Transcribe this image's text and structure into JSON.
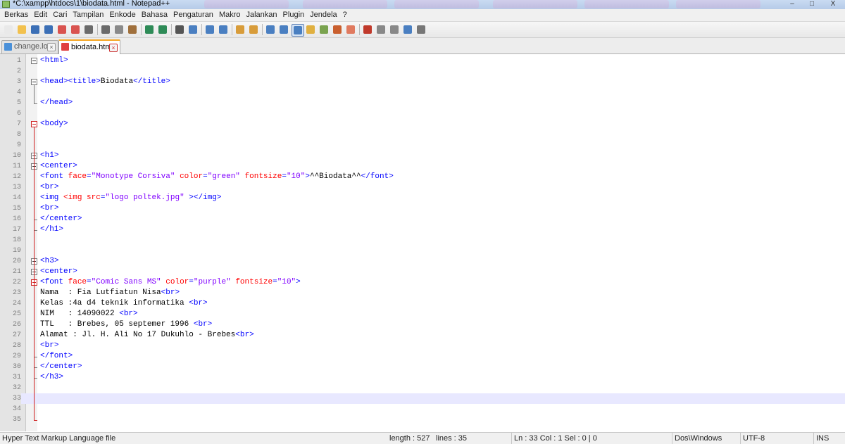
{
  "window": {
    "title": "*C:\\xampp\\htdocs\\1\\biodata.html - Notepad++",
    "controls": [
      "–",
      "□",
      "X"
    ]
  },
  "menu": [
    "Berkas",
    "Edit",
    "Cari",
    "Tampilan",
    "Enkode",
    "Bahasa",
    "Pengaturan",
    "Makro",
    "Jalankan",
    "Plugin",
    "Jendela",
    "?"
  ],
  "toolbar": {
    "buttons": [
      "new-file-icon",
      "open-file-icon",
      "save-icon",
      "save-all-icon",
      "close-icon",
      "close-all-icon",
      "print-icon",
      "cut-icon",
      "copy-icon",
      "paste-icon",
      "undo-icon",
      "redo-icon",
      "find-icon",
      "replace-icon",
      "zoom-in-icon",
      "zoom-out-icon",
      "sync-vertical-icon",
      "sync-horizontal-icon",
      "word-wrap-icon",
      "show-all-chars-icon",
      "indent-guide-icon",
      "user-language-icon",
      "function-list-icon",
      "doc-map-icon",
      "folder-workspace-icon",
      "macro-record-icon",
      "macro-stop-icon",
      "macro-play-icon",
      "macro-run-multiple-icon",
      "macro-save-icon"
    ]
  },
  "tabs": [
    {
      "label": "change.log",
      "active": false
    },
    {
      "label": "biodata.html",
      "active": true
    }
  ],
  "editor": {
    "current_line": 33,
    "lines": [
      "<html>",
      "",
      "<head><title>Biodata</title>",
      "",
      "</head>",
      "",
      "<body>",
      "",
      "",
      "<h1>",
      "<center>",
      "<font face=\"Monotype Corsiva\" color=\"green\" fontsize=\"10\">^^Biodata^^</font>",
      "<br>",
      "<img <img src=\"logo poltek.jpg\" ></img>",
      "<br>",
      "</center>",
      "</h1>",
      "",
      "",
      "<h3>",
      "<center>",
      "<font face=\"Comic Sans MS\" color=\"purple\" fontsize=\"10\">",
      "Nama  : Fia Lutfiatun Nisa<br>",
      "Kelas :4a d4 teknik informatika <br>",
      "NIM   : 14090022 <br>",
      "TTL   : Brebes, 05 septemer 1996 <br>",
      "Alamat : Jl. H. Ali No 17 Dukuhlo - Brebes<br>",
      "<br>",
      "</font>",
      "</center>",
      "</h3>",
      "",
      "",
      "",
      ""
    ]
  },
  "status": {
    "file_type": "Hyper Text Markup Language file",
    "length": "length : 527",
    "lines": "lines : 35",
    "position": "Ln : 33    Col : 1    Sel : 0 | 0",
    "eol": "Dos\\Windows",
    "encoding": "UTF-8",
    "mode": "INS"
  },
  "colors": {
    "tag": "#0000ff",
    "attribute": "#ff0000",
    "string": "#8000ff",
    "current_line": "#e8e8ff",
    "fold_marker": "#d02020"
  }
}
